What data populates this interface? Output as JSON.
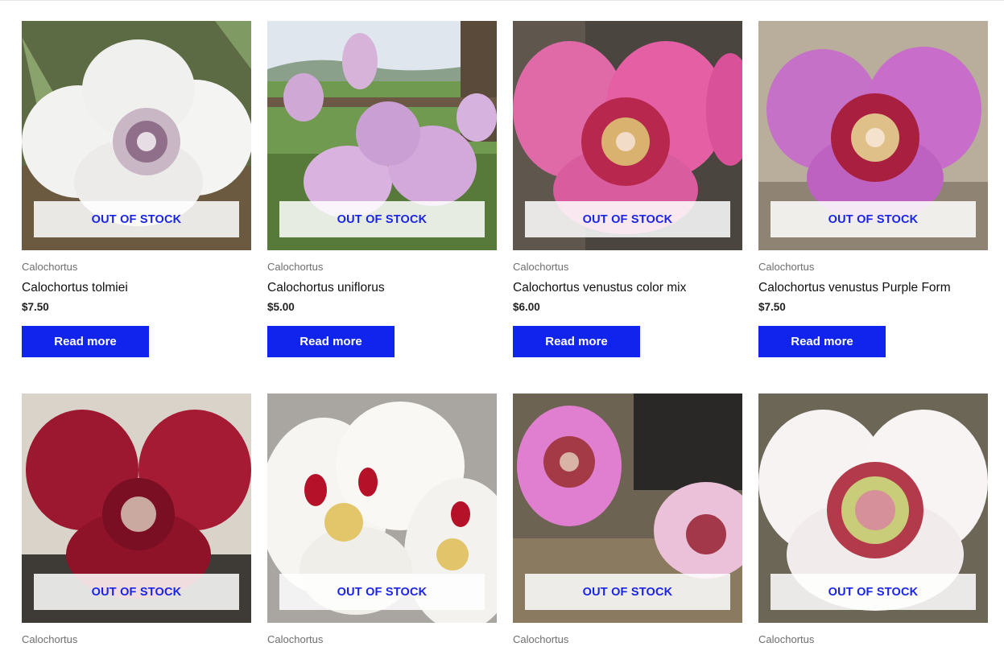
{
  "stock_badge": "OUT OF STOCK",
  "button_label": "Read more",
  "accent_color": "#1024ee",
  "products": [
    {
      "category": "Calochortus",
      "title": "Calochortus tolmiei",
      "price": "$7.50",
      "image": "white fringed mariposa lily"
    },
    {
      "category": "Calochortus",
      "title": "Calochortus uniflorus",
      "price": "$5.00",
      "image": "pale lilac tulip flowers by fence"
    },
    {
      "category": "Calochortus",
      "title": "Calochortus venustus color mix",
      "price": "$6.00",
      "image": "pink mariposa lily"
    },
    {
      "category": "Calochortus",
      "title": "Calochortus venustus Purple Form",
      "price": "$7.50",
      "image": "purple mariposa lily"
    },
    {
      "category": "Calochortus",
      "title": "",
      "price": "",
      "image": "dark red mariposa lily"
    },
    {
      "category": "Calochortus",
      "title": "",
      "price": "",
      "image": "white mariposa lilies with red spots"
    },
    {
      "category": "Calochortus",
      "title": "",
      "price": "",
      "image": "pink mariposa lilies in pots"
    },
    {
      "category": "Calochortus",
      "title": "",
      "price": "",
      "image": "white mariposa lily with red center"
    }
  ]
}
